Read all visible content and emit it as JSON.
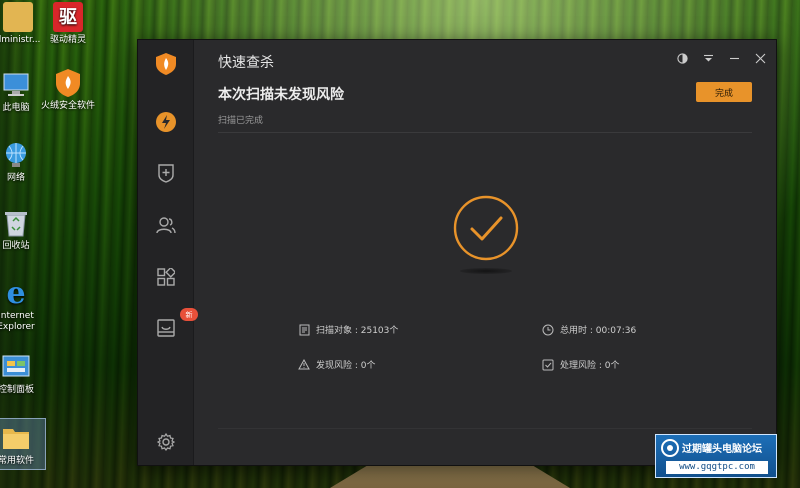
{
  "desktop": {
    "icons": [
      {
        "label": "dministr...",
        "icon": "user-folder-icon"
      },
      {
        "label": "驱动精灵",
        "icon": "driver-genius-icon",
        "glyph": "驱"
      },
      {
        "label": "此电脑",
        "icon": "computer-icon"
      },
      {
        "label": "火绒安全软件",
        "icon": "huorong-shield-icon"
      },
      {
        "label": "网络",
        "icon": "network-icon"
      },
      {
        "label": "回收站",
        "icon": "recycle-bin-icon"
      },
      {
        "label": "Internet Explorer",
        "icon": "ie-icon",
        "glyph": "e"
      },
      {
        "label": "控制面板",
        "icon": "control-panel-icon"
      },
      {
        "label": "常用软件",
        "icon": "folder-icon"
      }
    ]
  },
  "window": {
    "title": "快速查杀",
    "headline": "本次扫描未发现风险",
    "subtitle": "扫描已完成",
    "done_label": "完成",
    "accent_color": "#e8932a",
    "sidebar": {
      "items": [
        {
          "icon": "huorong-logo-icon"
        },
        {
          "icon": "lightning-icon"
        },
        {
          "icon": "shield-plus-icon"
        },
        {
          "icon": "users-icon"
        },
        {
          "icon": "apps-grid-icon"
        },
        {
          "icon": "gift-box-icon",
          "badge": "新"
        },
        {
          "icon": "gear-icon"
        }
      ]
    },
    "stats": {
      "scanned_label": "扫描对象 : 25103个",
      "time_label": "总用时 : 00:07:36",
      "found_label": "发现风险 : 0个",
      "handled_label": "处理风险 : 0个"
    }
  },
  "watermark": {
    "title": "过期罐头电脑论坛",
    "url": "www.gqgtpc.com"
  }
}
